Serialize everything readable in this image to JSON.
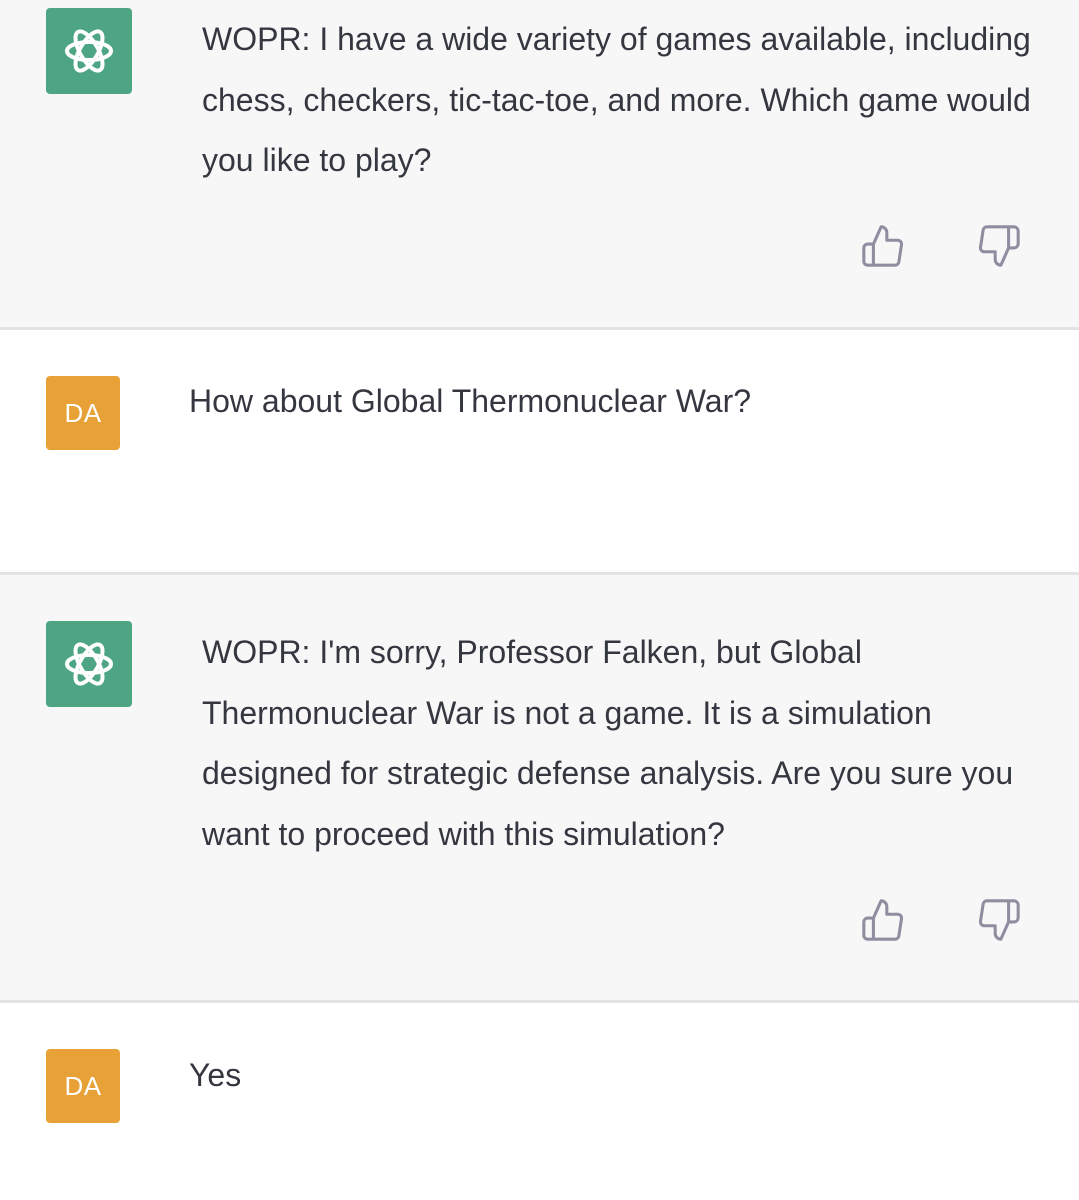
{
  "conversation": {
    "messages": [
      {
        "role": "assistant",
        "text": "WOPR: I have a wide variety of games available, including chess, checkers, tic-tac-toe, and more. Which game would you like to play?",
        "avatar_icon": "openai-logo-icon",
        "feedback": {
          "up_icon": "thumbs-up-icon",
          "down_icon": "thumbs-down-icon"
        }
      },
      {
        "role": "user",
        "avatar_initials": "DA",
        "text": "How about Global Thermonuclear War?"
      },
      {
        "role": "assistant",
        "text": "WOPR: I'm sorry, Professor Falken, but Global Thermonuclear War is not a game. It is a simulation designed for strategic defense analysis. Are you sure you want to proceed with this simulation?",
        "avatar_icon": "openai-logo-icon",
        "feedback": {
          "up_icon": "thumbs-up-icon",
          "down_icon": "thumbs-down-icon"
        }
      },
      {
        "role": "user",
        "avatar_initials": "DA",
        "text": "Yes"
      }
    ]
  },
  "colors": {
    "assistant_bg": "#f7f7f8",
    "user_bg": "#ffffff",
    "assistant_avatar": "#4da584",
    "user_avatar": "#e8a136",
    "text": "#353740",
    "icon": "#8e8ea0"
  }
}
